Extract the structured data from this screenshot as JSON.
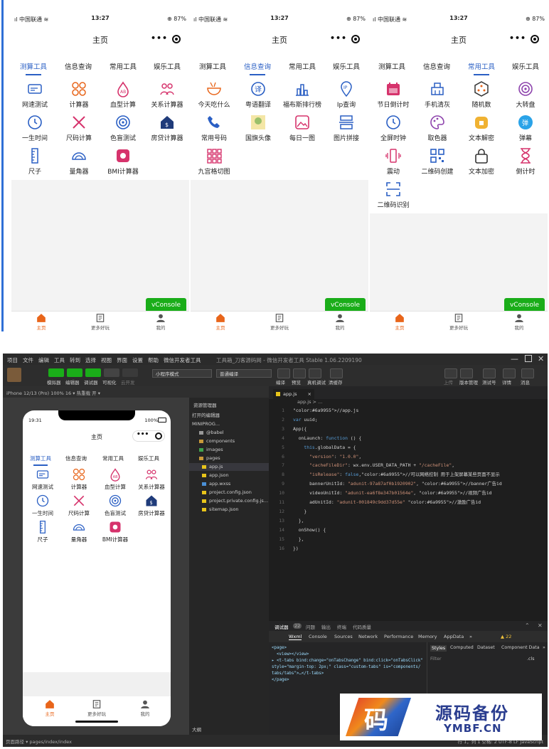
{
  "colors": {
    "accent": "#2a5fc4",
    "tab_active": "#e8651a",
    "vconsole": "#1aad19",
    "icon_blue": "#2a5fc4",
    "icon_orange": "#e8651a",
    "icon_red": "#d6336c",
    "icon_purple": "#8e44ad",
    "icon_navy": "#1f3b7a"
  },
  "phones": [
    {
      "status": {
        "carrier": "ıl 中国联通 ≋",
        "time": "13:27",
        "battery": "⊕ 87%"
      },
      "title": "主页",
      "active_tab": 0,
      "tabs": [
        "测算工具",
        "信息查询",
        "常用工具",
        "娱乐工具"
      ],
      "tools": [
        {
          "label": "网速测试",
          "icon": "speed-icon"
        },
        {
          "label": "计算器",
          "icon": "calculator-icon"
        },
        {
          "label": "血型计算",
          "icon": "blood-type-icon"
        },
        {
          "label": "关系计算器",
          "icon": "relationship-icon"
        },
        {
          "label": "一生时间",
          "icon": "clock-icon"
        },
        {
          "label": "尺码计算",
          "icon": "ruler-pencil-icon"
        },
        {
          "label": "色盲测试",
          "icon": "target-icon"
        },
        {
          "label": "房贷计算器",
          "icon": "house-icon"
        },
        {
          "label": "尺子",
          "icon": "ruler-icon"
        },
        {
          "label": "量角器",
          "icon": "protractor-icon"
        },
        {
          "label": "BMI计算器",
          "icon": "scale-icon"
        }
      ],
      "vconsole": "vConsole",
      "tabbar": [
        "主页",
        "更多好玩",
        "我的"
      ]
    },
    {
      "status": {
        "carrier": "ıl 中国联通 ≋",
        "time": "13:27",
        "battery": "⊕ 87%"
      },
      "title": "主页",
      "active_tab": 1,
      "tabs": [
        "测算工具",
        "信息查询",
        "常用工具",
        "娱乐工具"
      ],
      "tools": [
        {
          "label": "今天吃什么",
          "icon": "food-bowl-icon"
        },
        {
          "label": "粤语翻译",
          "icon": "translate-icon"
        },
        {
          "label": "福布斯排行榜",
          "icon": "ranking-icon"
        },
        {
          "label": "Ip查询",
          "icon": "ip-icon"
        },
        {
          "label": "常用号码",
          "icon": "phone-icon"
        },
        {
          "label": "国旗头像",
          "icon": "avatar-image-icon"
        },
        {
          "label": "每日一图",
          "icon": "picture-icon"
        },
        {
          "label": "图片拼接",
          "icon": "image-stitch-icon"
        },
        {
          "label": "九宫格切图",
          "icon": "grid-nine-icon"
        }
      ],
      "vconsole": "vConsole",
      "tabbar": [
        "主页",
        "更多好玩",
        "我的"
      ]
    },
    {
      "status": {
        "carrier": "ıl 中国联通 ≋",
        "time": "13:27",
        "battery": "⊕ 87%"
      },
      "title": "主页",
      "active_tab": 2,
      "tabs": [
        "测算工具",
        "信息查询",
        "常用工具",
        "娱乐工具"
      ],
      "tools": [
        {
          "label": "节日倒计时",
          "icon": "calendar-icon"
        },
        {
          "label": "手机清灰",
          "icon": "broom-icon"
        },
        {
          "label": "随机数",
          "icon": "dice-icon"
        },
        {
          "label": "大转盘",
          "icon": "wheel-icon"
        },
        {
          "label": "全屏时钟",
          "icon": "clock-icon"
        },
        {
          "label": "取色器",
          "icon": "palette-icon"
        },
        {
          "label": "文本解密",
          "icon": "unlock-icon"
        },
        {
          "label": "弹幕",
          "icon": "barrage-icon"
        },
        {
          "label": "震动",
          "icon": "vibrate-icon"
        },
        {
          "label": "二维码创建",
          "icon": "qrcode-icon"
        },
        {
          "label": "文本加密",
          "icon": "lock-icon"
        },
        {
          "label": "倒计时",
          "icon": "hourglass-icon"
        },
        {
          "label": "二维码识别",
          "icon": "scan-icon"
        }
      ],
      "vconsole": "vConsole",
      "tabbar": [
        "主页",
        "更多好玩",
        "我的"
      ]
    }
  ],
  "ide": {
    "menu": [
      "项目",
      "文件",
      "编辑",
      "工具",
      "转到",
      "选择",
      "视图",
      "界面",
      "设置",
      "帮助",
      "微信开发者工具"
    ],
    "window_title": "工具箱_刀客源码网 - 微信开发者工具 Stable 1.06.2209190",
    "toolbar": {
      "left": [
        "模拟器",
        "编辑器",
        "调试器",
        "可视化",
        "云开发"
      ],
      "mode": "小程序模式",
      "compile": "普通编译",
      "mid": [
        "编译",
        "预览",
        "真机调试",
        "清缓存"
      ],
      "right": [
        "上传",
        "版本管理",
        "测试号",
        "详情",
        "消息"
      ]
    },
    "sim_header": "iPhone 12/13 (Pro) 100% 16 ▾    热重载 开 ▾",
    "sim": {
      "time": "19:31",
      "battery": "100%",
      "title": "主页",
      "tabs": [
        "测算工具",
        "信息查询",
        "常用工具",
        "娱乐工具"
      ],
      "tools": [
        "网速测试",
        "计算器",
        "血型计算",
        "关系计算器",
        "一生时间",
        "尺码计算",
        "色盲测试",
        "房贷计算器",
        "尺子",
        "量角器",
        "BMI计算器"
      ],
      "tabbar": [
        "主页",
        "更多好玩",
        "我的"
      ]
    },
    "explorer": {
      "title": "资源管理器",
      "open_editors": "打开的编辑器",
      "project": "MINIPROG...",
      "items": [
        "@babel",
        "components",
        "images",
        "pages",
        "app.js",
        "app.json",
        "app.wxss",
        "project.config.json",
        "project.private.config.js...",
        "sitemap.json"
      ],
      "outline": "大纲"
    },
    "editor_tab": "app.js",
    "breadcrumb": "app.js > ...",
    "code": [
      "//app.js",
      "var uuid;",
      "App({",
      "  onLaunch: function () {",
      "    this.globalData = {",
      "      \"version\": \"1.0.0\",",
      "      \"cacheFileDir\": wx.env.USER_DATA_PATH + \"/cacheFile\",",
      "      \"isRelease\": false,//可以网络控制 用于上架屏幕某些页面不显示",
      "      bannerUnitId: \"adunit-97a87af0b1920902\", //banner广告id",
      "      videoUnitId: \"adunit-ea6f8e347b01564e\", //视频广告id",
      "      adUnitId: \"adunit-001849c9dd37d55e\" //激励广告id",
      "    }",
      "  },",
      "  onShow() {",
      "  },",
      "})"
    ],
    "devtools": {
      "tabs": [
        "调试器",
        "22",
        "问题",
        "输出",
        "终端",
        "代码质量"
      ],
      "panels": [
        "Wxml",
        "Console",
        "Sources",
        "Network",
        "Performance",
        "Memory",
        "AppData",
        "»"
      ],
      "warn": "▲ 22",
      "style_tabs": [
        "Styles",
        "Computed",
        "Dataset",
        "Component Data",
        "»"
      ],
      "filter": "Filter",
      "cls": ".cls",
      "dom": [
        "<page>",
        "  <view></view>",
        "▸ <t-tabs bind:change=\"onTabsChange\" bind:click=\"onTabsClick\"",
        "style=\"margin-top: 2px;\" class=\"custom-tabs\" is=\"components/",
        "tabs/tabs\">…</t-tabs>",
        "</page>"
      ]
    },
    "status": {
      "path": "页面路径 ▾  pages/index/index",
      "right": "行 1，列 1   空格: 2   UTF-8   LF   JavaScript"
    }
  },
  "watermark": {
    "char": "码",
    "text": "源码备份",
    "url": "YMBF.CN"
  }
}
